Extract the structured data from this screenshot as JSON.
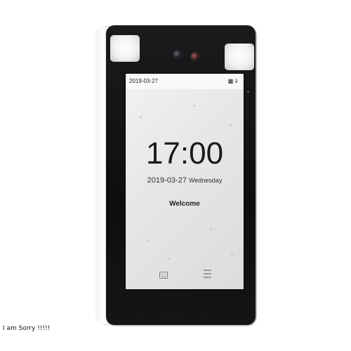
{
  "device": {
    "status_bar": {
      "date": "2019-03-27"
    },
    "screen": {
      "time": "17:00",
      "date": "2019-03-27",
      "weekday": "Wednesday",
      "greeting": "Welcome"
    },
    "icons": {
      "status": [
        "signal-icon",
        "network-icon"
      ],
      "bottom": [
        "keyboard-icon",
        "menu-icon"
      ]
    }
  },
  "caption": "I am Sorry !!!!!"
}
